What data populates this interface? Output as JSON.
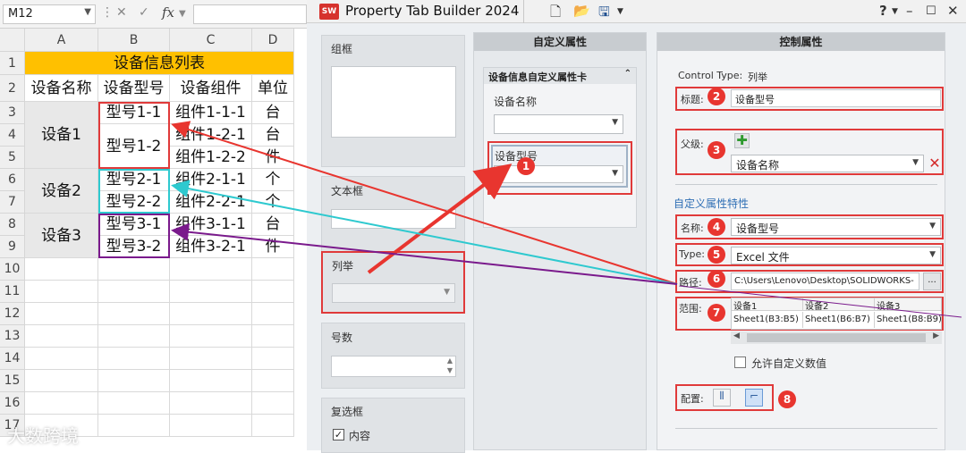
{
  "excel": {
    "name_box": "M12",
    "fx": "fx",
    "columns": [
      "A",
      "B",
      "C",
      "D"
    ],
    "rows": [
      "1",
      "2",
      "3",
      "4",
      "5",
      "6",
      "7",
      "8",
      "9",
      "10",
      "11",
      "12",
      "13",
      "14",
      "15",
      "16",
      "17"
    ],
    "title": "设备信息列表",
    "headers": [
      "设备名称",
      "设备型号",
      "设备组件",
      "单位"
    ],
    "devices": [
      "设备1",
      "设备2",
      "设备3"
    ],
    "models": [
      "型号1-1",
      "型号1-2",
      "型号2-1",
      "型号2-2",
      "型号3-1",
      "型号3-2"
    ],
    "components": [
      "组件1-1-1",
      "组件1-2-1",
      "组件1-2-2",
      "组件2-1-1",
      "组件2-2-1",
      "组件3-1-1",
      "组件3-2-1"
    ],
    "units": [
      "台",
      "台",
      "件",
      "个",
      "个",
      "台",
      "件"
    ]
  },
  "app": {
    "title": "Property Tab Builder 2024",
    "logo": "SW",
    "help": "?",
    "toolbox": {
      "groupbox": "组框",
      "textbox": "文本框",
      "list": "列举",
      "number": "号数",
      "checkbox": "复选框",
      "checkbox_content": "内容"
    },
    "custom": {
      "header": "自定义属性",
      "card_title": "设备信息自定义属性卡",
      "field1_label": "设备名称",
      "field2_label": "设备型号"
    },
    "control": {
      "header": "控制属性",
      "control_type_label": "Control Type:",
      "control_type_value": "列举",
      "caption_label": "标题:",
      "caption_value": "设备型号",
      "parent_label": "父级:",
      "parent_value": "设备名称",
      "section": "自定义属性特性",
      "name_label": "名称:",
      "name_value": "设备型号",
      "type_label": "Type:",
      "type_value": "Excel 文件",
      "path_label": "路径:",
      "path_value": "C:\\Users\\Lenovo\\Desktop\\SOLIDWORKS-",
      "browse": "...",
      "range_label": "范围:",
      "range_cols": [
        "设备1",
        "设备2",
        "设备3"
      ],
      "range_vals": [
        "Sheet1(B3:B5)",
        "Sheet1(B6:B7)",
        "Sheet1(B8:B9)"
      ],
      "allow_custom": "允许自定义数值",
      "config_label": "配置:"
    },
    "markers": [
      "1",
      "2",
      "3",
      "4",
      "5",
      "6",
      "7",
      "8"
    ]
  },
  "watermark": "大数跨境",
  "colors": {
    "red": "#e03a3a",
    "cyan": "#2ec9cf",
    "purple": "#7a1a8c",
    "title_fill": "#ffc000"
  }
}
